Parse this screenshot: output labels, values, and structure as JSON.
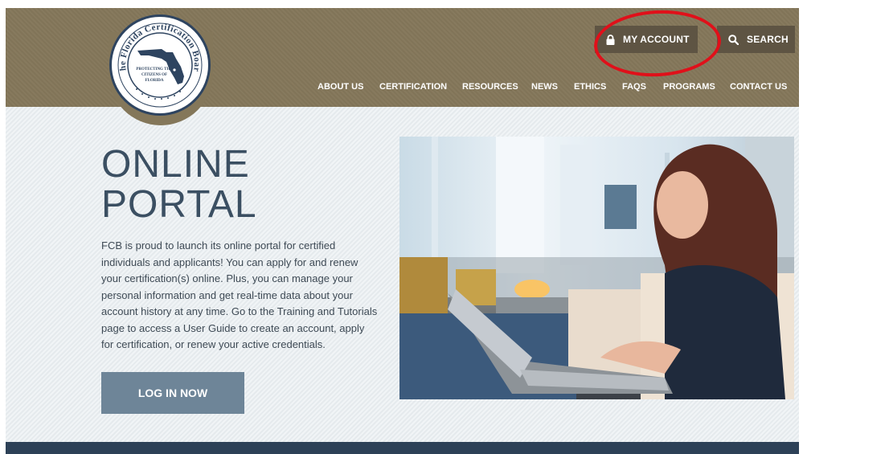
{
  "logo": {
    "ring_text": "The Florida Certification Board",
    "center_text": "PROTECTING THE CITIZENS OF FLORIDA",
    "icon": "florida-map-seal"
  },
  "header": {
    "my_account_label": "MY ACCOUNT",
    "my_account_icon": "lock-icon",
    "search_label": "SEARCH",
    "search_icon": "search-icon"
  },
  "nav": {
    "items": [
      "ABOUT US",
      "CERTIFICATION",
      "RESOURCES",
      "NEWS",
      "ETHICS",
      "FAQS",
      "PROGRAMS",
      "CONTACT US"
    ]
  },
  "main": {
    "title": "ONLINE\nPORTAL",
    "intro": "FCB is proud to launch its online portal for certified individuals and applicants! You can apply for and renew your certification(s) online. Plus, you can manage your personal information and get real-time data about your account history at any time. Go to the Training and Tutorials page to access a User Guide to create an account, apply for certification, or renew your active credentials.",
    "login_button": "LOG IN NOW"
  },
  "photo": {
    "subject": "woman-typing-on-laptop"
  },
  "colors": {
    "header_bg": "#84775a",
    "button_dark": "#5e5443",
    "navy": "#2e4460",
    "login_button": "#6e8598",
    "content_bg": "#e9eef1",
    "annotation_red": "#e0101a"
  }
}
